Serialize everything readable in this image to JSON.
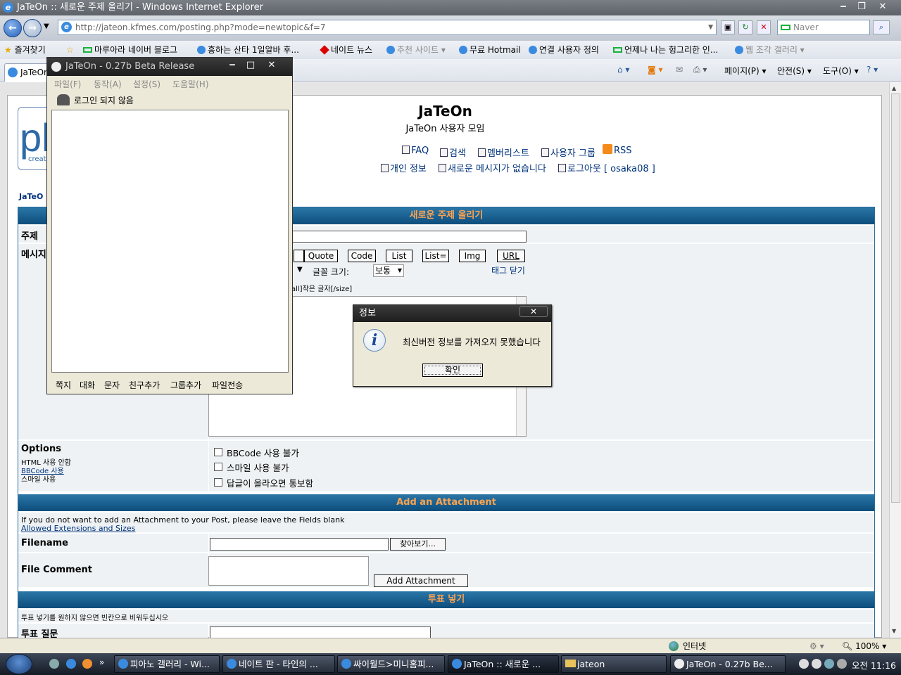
{
  "ie": {
    "title": "JaTeOn :: 새로운 주제 올리기 - Windows Internet Explorer",
    "address": "http://jateon.kfmes.com/posting.php?mode=newtopic&f=7",
    "search_placeholder": "Naver",
    "favorites_label": "즐겨찾기",
    "favorites": [
      "마루아라 네이버 블로그",
      "흥하는 산타 1일알바 후...",
      "네이트 뉴스",
      "추천 사이트 ▾",
      "무료 Hotmail",
      "연결 사용자 정의",
      "언제나 나는 헝그리한 인...",
      "웹 조각 갤러리 ▾"
    ],
    "tab_label": "JaTeOn",
    "commands": {
      "page": "페이지(P) ▾",
      "safety": "안전(S) ▾",
      "tools": "도구(O) ▾"
    }
  },
  "forum": {
    "site_name": "JaTeOn",
    "site_desc": "JaTeOn 사용자 모임",
    "logo_text": "ph",
    "logo_sub": "creat",
    "links_row1": [
      "FAQ",
      "검색",
      "멤버리스트",
      "사용자 그룹",
      "RSS"
    ],
    "links_row2": [
      "개인 정보",
      "새로운 메시지가 없습니다",
      "로그아웃 [ osaka08 ]"
    ],
    "breadcrumb": "JaTeO",
    "post_header": "새로운 주제 올리기",
    "subject_label": "주제",
    "message_label": "메시지",
    "bbcode_buttons": [
      "Quote",
      "Code",
      "List",
      "List=",
      "Img",
      "URL"
    ],
    "font_size_label": "글꼴 크기:",
    "font_size_value": "보통",
    "close_tags": "태그 닫기",
    "hint": "all]작은 글자[/size]",
    "options_label": "Options",
    "options_html": "HTML 사용 안함",
    "options_bbcode": "BBCode 사용",
    "options_smile": "스마일 사용",
    "opt_checks": [
      "BBCode 사용 불가",
      "스마일 사용 불가",
      "답글이 올라오면 통보함"
    ],
    "attach_header": "Add an Attachment",
    "attach_note": "If you do not want to add an Attachment to your Post, please leave the Fields blank",
    "attach_link": "Allowed Extensions and Sizes",
    "filename_label": "Filename",
    "browse_button": "찾아보기...",
    "file_comment_label": "File Comment",
    "add_attachment_button": "Add Attachment",
    "poll_header": "투표 넣기",
    "poll_note": "투표 넣기를 원하지 않으면 빈칸으로 비워두십시오",
    "poll_question_label": "투표 질문"
  },
  "jateon": {
    "title": "JaTeOn - 0.27b Beta Release",
    "menu": [
      "파일(F)",
      "동작(A)",
      "설정(S)",
      "도움말(H)"
    ],
    "status": "로그인 되지 않음",
    "bottom": [
      "쪽지",
      "대화",
      "문자",
      "친구추가",
      "그룹추가",
      "파일전송"
    ]
  },
  "dialog": {
    "title": "정보",
    "message": "최신버전 정보를 가져오지 못했습니다",
    "ok": "확인"
  },
  "statusbar": {
    "zone": "인터넷",
    "zoom": "100%"
  },
  "taskbar": {
    "tasks": [
      "피아노 갤러리 - Wi...",
      "네이트 판 - 타인의 ...",
      "싸이월드>미니홈피...",
      "JaTeOn :: 새로운 ...",
      "jateon",
      "JaTeOn - 0.27b Be..."
    ],
    "clock": "오전 11:16"
  }
}
